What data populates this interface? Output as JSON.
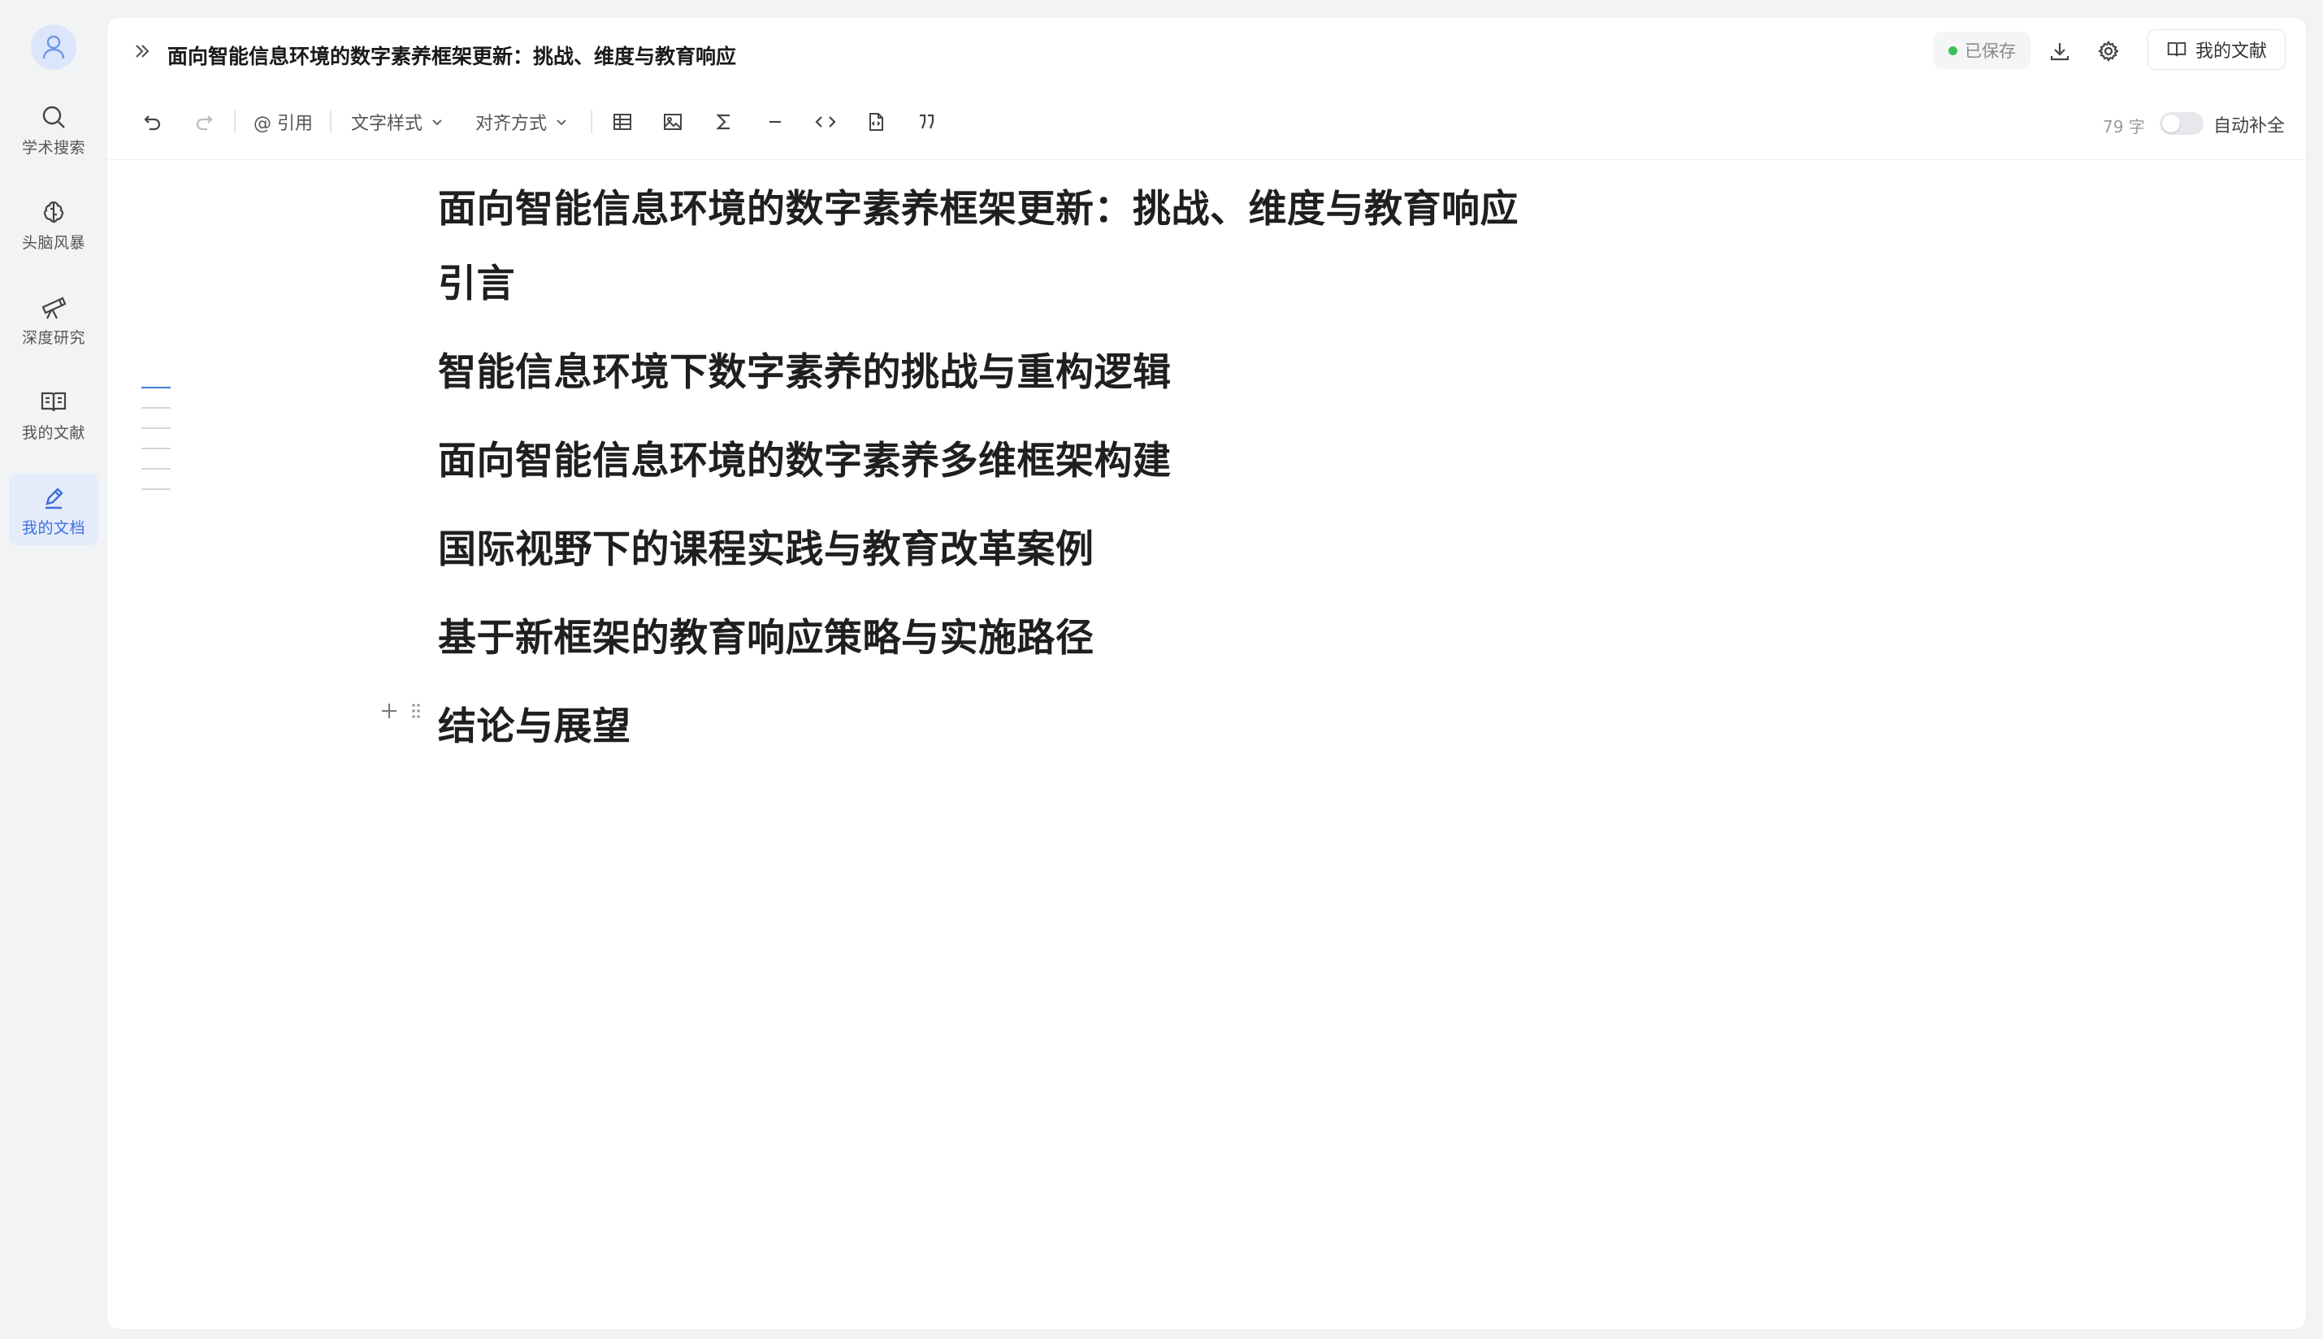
{
  "sidebar": {
    "items": [
      {
        "label": "学术搜索",
        "icon": "search-icon"
      },
      {
        "label": "头脑风暴",
        "icon": "brain-icon"
      },
      {
        "label": "深度研究",
        "icon": "telescope-icon"
      },
      {
        "label": "我的文献",
        "icon": "book-icon"
      },
      {
        "label": "我的文档",
        "icon": "pen-icon",
        "active": true
      }
    ]
  },
  "header": {
    "doc_title": "面向智能信息环境的数字素养框架更新：挑战、维度与教育响应",
    "saved_label": "已保存",
    "library_button": "我的文献"
  },
  "toolbar": {
    "cite_label": "@ 引用",
    "text_style_label": "文字样式",
    "align_label": "对齐方式",
    "word_count": "79 字",
    "autocomplete_label": "自动补全",
    "autocomplete_on": false
  },
  "document": {
    "title": "面向智能信息环境的数字素养框架更新：挑战、维度与教育响应",
    "sections": [
      "引言",
      "智能信息环境下数字素养的挑战与重构逻辑",
      "面向智能信息环境的数字素养多维框架构建",
      "国际视野下的课程实践与教育改革案例",
      "基于新框架的教育响应策略与实施路径",
      "结论与展望"
    ]
  },
  "colors": {
    "accent": "#3d6fe0",
    "saved_dot": "#3cc05b",
    "outline_active": "#3b82d6"
  }
}
